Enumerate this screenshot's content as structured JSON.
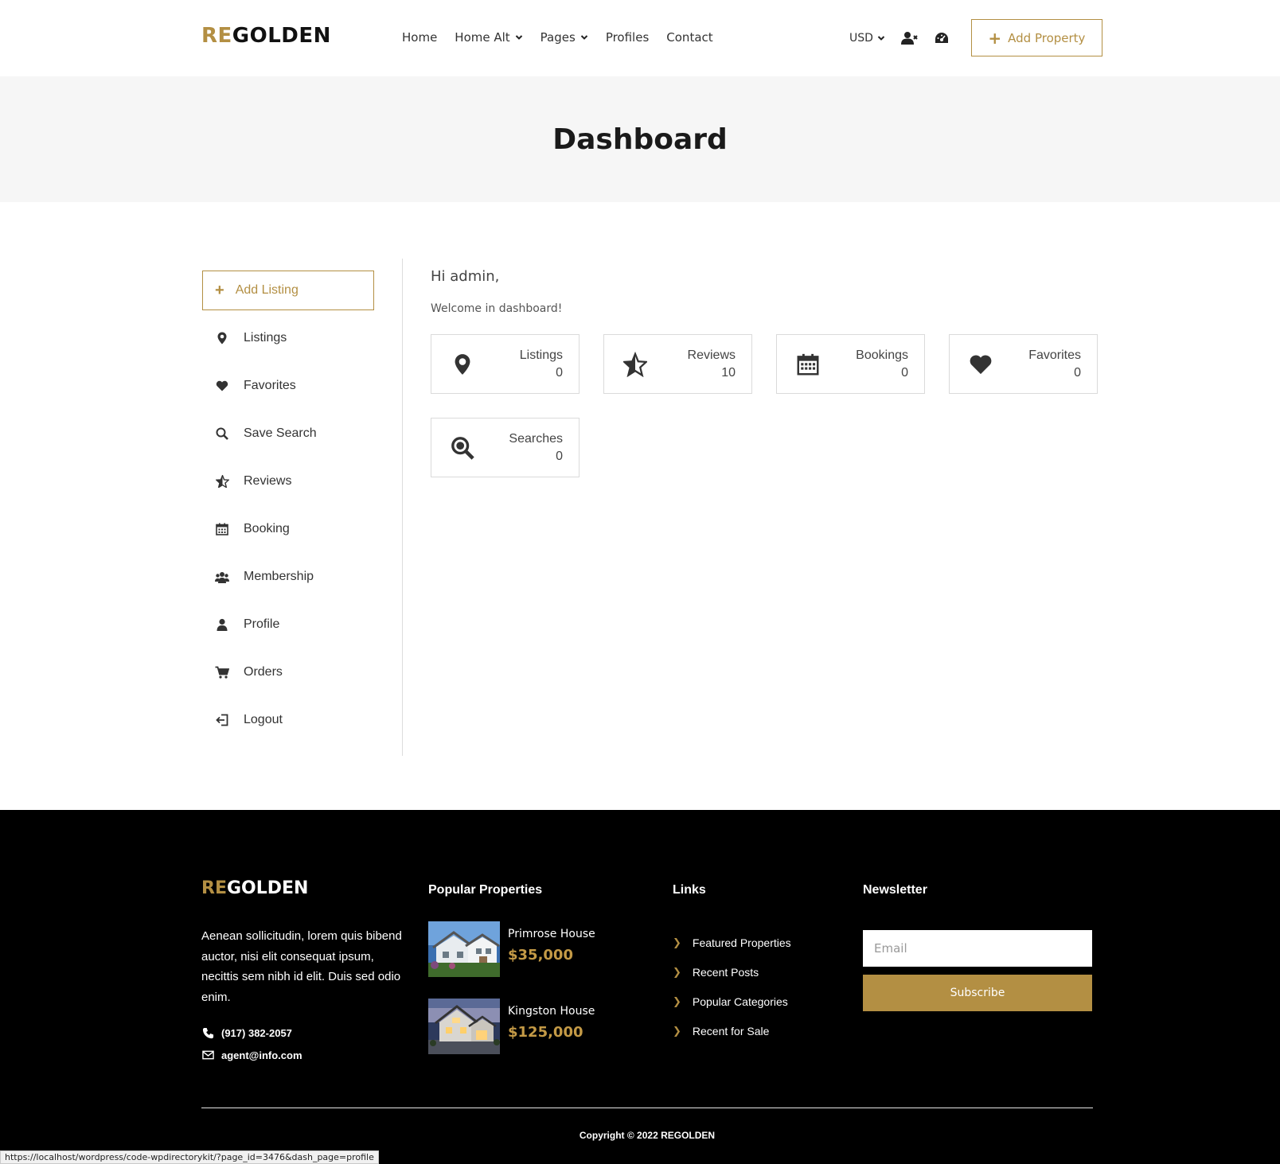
{
  "header": {
    "logo_accent": "RE",
    "logo_rest": "GOLDEN",
    "nav": [
      {
        "label": "Home",
        "dropdown": false
      },
      {
        "label": "Home Alt",
        "dropdown": true
      },
      {
        "label": "Pages",
        "dropdown": true
      },
      {
        "label": "Profiles",
        "dropdown": false
      },
      {
        "label": "Contact",
        "dropdown": false
      }
    ],
    "currency": "USD",
    "add_property": "Add Property"
  },
  "banner": {
    "title": "Dashboard"
  },
  "sidebar": {
    "add_listing": "Add Listing",
    "items": [
      {
        "label": "Listings",
        "icon": "map-pin-icon"
      },
      {
        "label": "Favorites",
        "icon": "heart-icon"
      },
      {
        "label": "Save Search",
        "icon": "search-icon"
      },
      {
        "label": "Reviews",
        "icon": "star-icon"
      },
      {
        "label": "Booking",
        "icon": "calendar-icon"
      },
      {
        "label": "Membership",
        "icon": "users-icon"
      },
      {
        "label": "Profile",
        "icon": "user-icon"
      },
      {
        "label": "Orders",
        "icon": "cart-icon"
      },
      {
        "label": "Logout",
        "icon": "logout-icon"
      }
    ]
  },
  "main": {
    "greeting": "Hi admin,",
    "welcome": "Welcome in dashboard!",
    "cards": [
      {
        "label": "Listings",
        "value": "0",
        "icon": "map-pin-icon"
      },
      {
        "label": "Reviews",
        "value": "10",
        "icon": "star-icon"
      },
      {
        "label": "Bookings",
        "value": "0",
        "icon": "calendar-icon"
      },
      {
        "label": "Favorites",
        "value": "0",
        "icon": "heart-icon"
      },
      {
        "label": "Searches",
        "value": "0",
        "icon": "search-icon"
      }
    ]
  },
  "footer": {
    "logo_accent": "RE",
    "logo_rest": "GOLDEN",
    "about": "Aenean sollicitudin, lorem quis bibend auctor, nisi elit consequat ipsum, necittis sem nibh id elit. Duis sed odio enim.",
    "phone": "(917) 382-2057",
    "email": "agent@info.com",
    "popular_heading": "Popular Properties",
    "properties": [
      {
        "name": "Primrose House",
        "price": "$35,000"
      },
      {
        "name": "Kingston House",
        "price": "$125,000"
      }
    ],
    "links_heading": "Links",
    "links": [
      "Featured Properties",
      "Recent Posts",
      "Popular Categories",
      "Recent for Sale"
    ],
    "newsletter_heading": "Newsletter",
    "email_placeholder": "Email",
    "subscribe_label": "Subscribe",
    "copyright": "Copyright © 2022 REGOLDEN"
  },
  "status_url": "https://localhost/wordpress/code-wpdirectorykit/?page_id=3476&dash_page=profile",
  "colors": {
    "accent": "#b38f43",
    "footer_bg": "#000000",
    "banner_bg": "#f6f6f6"
  }
}
